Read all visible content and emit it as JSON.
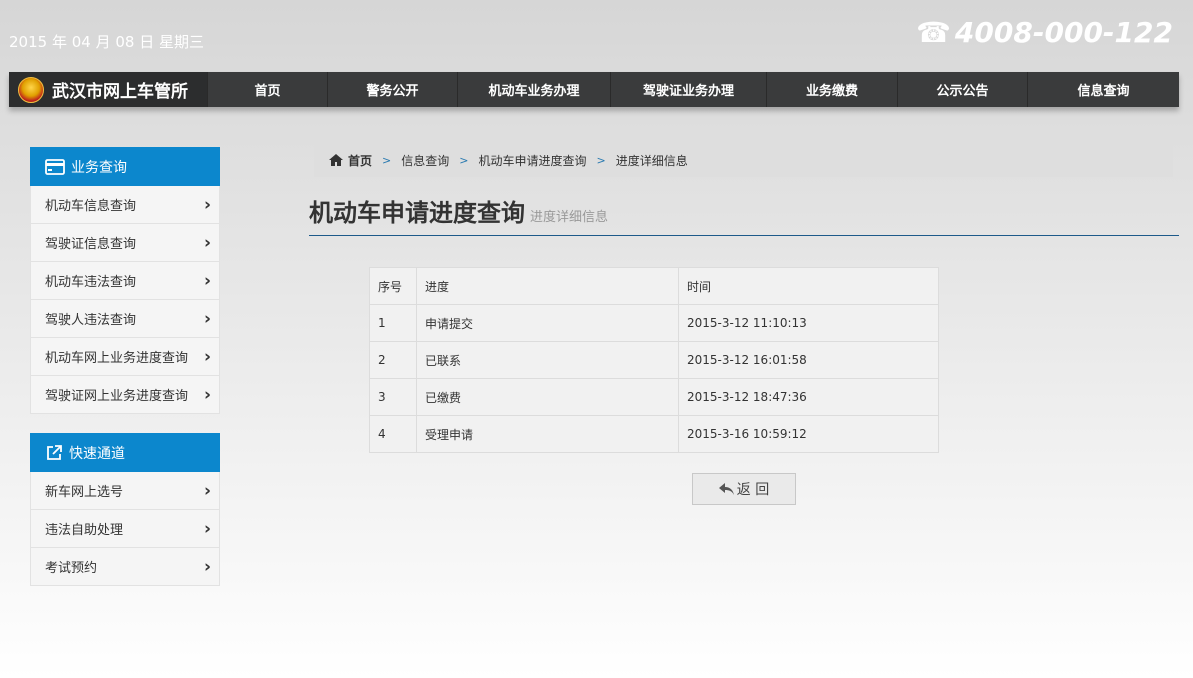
{
  "header": {
    "date": "2015 年 04 月 08 日 星期三",
    "phone": "4008-000-122",
    "brand": "武汉市网上车管所"
  },
  "nav": {
    "items": [
      "首页",
      "警务公开",
      "机动车业务办理",
      "驾驶证业务办理",
      "业务缴费",
      "公示公告",
      "信息查询"
    ]
  },
  "sidebar": {
    "sections": [
      {
        "title": "业务查询",
        "items": [
          "机动车信息查询",
          "驾驶证信息查询",
          "机动车违法查询",
          "驾驶人违法查询",
          "机动车网上业务进度查询",
          "驾驶证网上业务进度查询"
        ]
      },
      {
        "title": "快速通道",
        "items": [
          "新车网上选号",
          "违法自助处理",
          "考试预约"
        ]
      }
    ]
  },
  "breadcrumb": [
    "首页",
    "信息查询",
    "机动车申请进度查询",
    "进度详细信息"
  ],
  "page": {
    "title": "机动车申请进度查询",
    "subtitle": "进度详细信息"
  },
  "table": {
    "headers": [
      "序号",
      "进度",
      "时间"
    ],
    "rows": [
      [
        "1",
        "申请提交",
        "2015-3-12 11:10:13"
      ],
      [
        "2",
        "已联系",
        "2015-3-12 16:01:58"
      ],
      [
        "3",
        "已缴费",
        "2015-3-12 18:47:36"
      ],
      [
        "4",
        "受理申请",
        "2015-3-16 10:59:12"
      ]
    ]
  },
  "back_button": "返 回",
  "colors": {
    "accent": "#0c87cd",
    "nav_bg": "#3a3b3c",
    "rule": "#1d5a8a"
  }
}
